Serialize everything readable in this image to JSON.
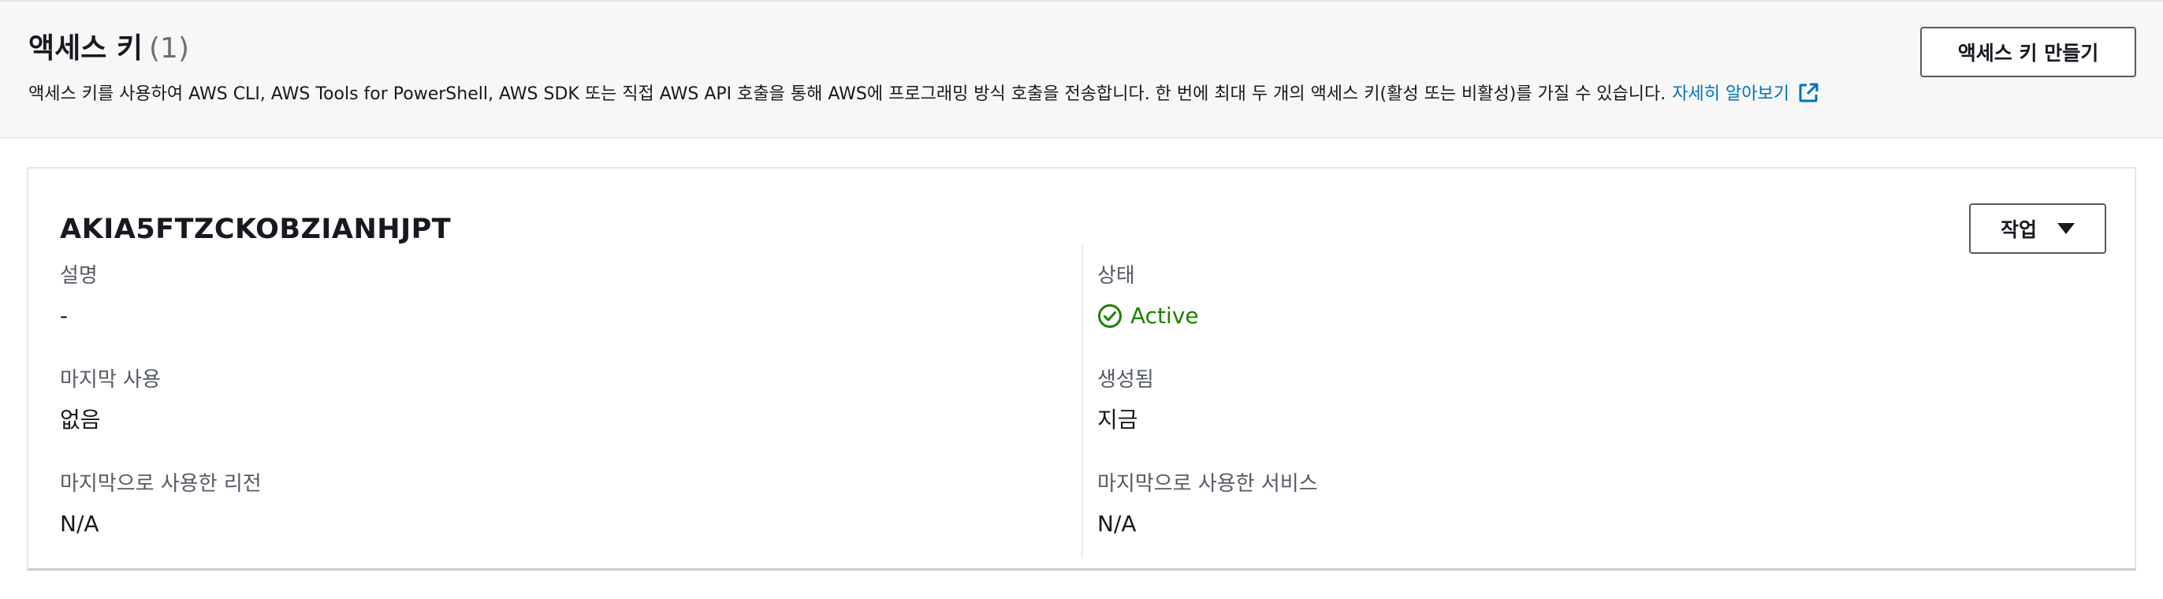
{
  "header": {
    "title": "액세스 키",
    "count": "(1)",
    "description": "액세스 키를 사용하여 AWS CLI, AWS Tools for PowerShell, AWS SDK 또는 직접 AWS API 호출을 통해 AWS에 프로그래밍 방식 호출을 전송합니다. 한 번에 최대 두 개의 액세스 키(활성 또는 비활성)를 가질 수 있습니다.",
    "learn_more": "자세히 알아보기",
    "create_button": "액세스 키 만들기"
  },
  "key": {
    "id": "AKIA5FTZCKOBZIANHJPT",
    "actions_label": "작업",
    "fields": {
      "description": {
        "label": "설명",
        "value": "-"
      },
      "status": {
        "label": "상태",
        "value": "Active",
        "color": "#1d8102"
      },
      "last_used": {
        "label": "마지막 사용",
        "value": "없음"
      },
      "created": {
        "label": "생성됨",
        "value": "지금"
      },
      "last_region": {
        "label": "마지막으로 사용한 리전",
        "value": "N/A"
      },
      "last_service": {
        "label": "마지막으로 사용한 서비스",
        "value": "N/A"
      }
    }
  },
  "colors": {
    "link": "#0073bb",
    "status_active": "#1d8102"
  }
}
